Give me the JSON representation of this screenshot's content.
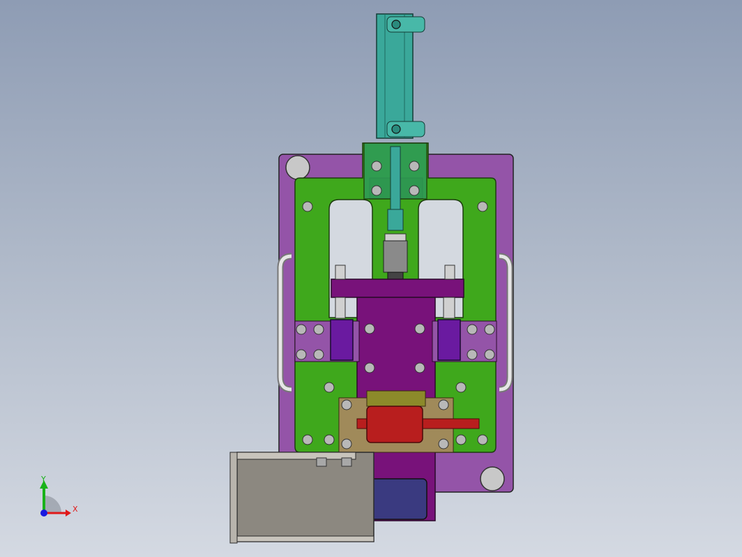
{
  "triad": {
    "y_label": "Y",
    "x_label": "X",
    "y_color": "#19b219",
    "x_color": "#e01919",
    "z_color": "#1919e0"
  },
  "colors": {
    "background_top": "#8e9cb4",
    "background_bottom": "#d4d9e2",
    "base_plate": "#9454a8",
    "frame": "#3fa81c",
    "cylinder": "#3aa89a",
    "carriage": "#78127a",
    "clamp_block": "#6a1aa0",
    "workpiece": "#b81e1e",
    "tray": "#8c8880",
    "bronze": "#a08a5a"
  },
  "icons": {
    "view_triad": "xyz-triad-icon"
  }
}
